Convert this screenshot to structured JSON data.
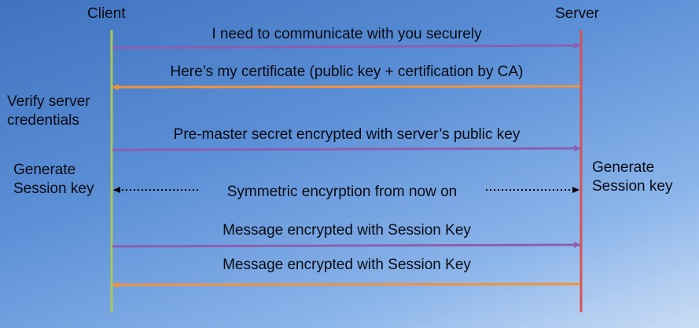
{
  "parties": {
    "client": "Client",
    "server": "Server"
  },
  "notes": {
    "verify_line1": "Verify server",
    "verify_line2": "credentials",
    "client_gen_line1": "Generate",
    "client_gen_line2": "Session key",
    "server_gen_line1": "Generate",
    "server_gen_line2": "Session key"
  },
  "messages": [
    {
      "text": "I need to communicate with you securely",
      "direction": "client-to-server",
      "color": "#8b5fb0"
    },
    {
      "text": "Here’s my certificate (public key + certification by CA)",
      "direction": "server-to-client",
      "color": "#f0923e"
    },
    {
      "text": "Pre-master secret encrypted with server’s public key",
      "direction": "client-to-server",
      "color": "#8b5fb0"
    },
    {
      "text": "Symmetric encyrption from now on",
      "direction": "both",
      "color": "#000000"
    },
    {
      "text": "Message encrypted with Session Key",
      "direction": "client-to-server",
      "color": "#8b5fb0"
    },
    {
      "text": "Message encrypted with Session Key",
      "direction": "server-to-client",
      "color": "#f0923e"
    }
  ],
  "colors": {
    "client_lifeline": "#a8c85a",
    "server_lifeline": "#d9534f"
  }
}
